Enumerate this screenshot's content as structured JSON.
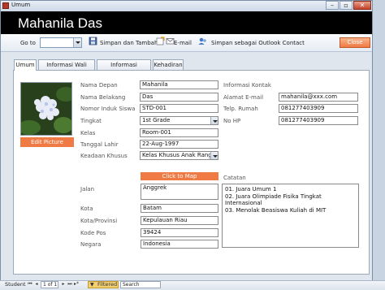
{
  "window": {
    "title": "Umum"
  },
  "header": {
    "title": "Mahanila Das"
  },
  "toolbar": {
    "goto_label": "Go to",
    "goto_value": "",
    "save_new_label": "Simpan dan Tambah",
    "email_label": "E-mail",
    "save_outlook_label": "Simpan sebagai  Outlook Contact",
    "close_label": "Close"
  },
  "tabs": [
    "Umum",
    "Informasi Wali Murid",
    "Informasi Kesehatan",
    "Kehadiran"
  ],
  "photo": {
    "edit_label": "Edit Picture"
  },
  "form": {
    "nama_depan": {
      "label": "Nama Depan",
      "value": "Mahanila"
    },
    "nama_belakang": {
      "label": "Nama Belakang",
      "value": "Das"
    },
    "nomor_induk": {
      "label": "Nomor Induk Siswa",
      "value": "STD-001"
    },
    "tingkat": {
      "label": "Tingkat",
      "value": "1st Grade"
    },
    "kelas": {
      "label": "Kelas",
      "value": "Room-001"
    },
    "tanggal_lahir": {
      "label": "Tanggal Lahir",
      "value": "22-Aug-1997"
    },
    "keadaan_khusus": {
      "label": "Keadaan Khusus",
      "value": "Kelas Khusus Anak Rangkir"
    }
  },
  "contact": {
    "section_title": "Informasi Kontak",
    "email": {
      "label": "Alamat E-mail",
      "value": "mahanila@xxx.com"
    },
    "telp": {
      "label": "Telp. Rumah",
      "value": "081277403909"
    },
    "hp": {
      "label": "No HP",
      "value": "081277403909"
    }
  },
  "address": {
    "map_label": "Click to Map",
    "jalan": {
      "label": "Jalan",
      "value": "Anggrek"
    },
    "kota": {
      "label": "Kota",
      "value": "Batam"
    },
    "provinsi": {
      "label": "Kota/Provinsi",
      "value": "Kepulauan Riau"
    },
    "kode_pos": {
      "label": "Kode Pos",
      "value": "39424"
    },
    "negara": {
      "label": "Negara",
      "value": "Indonesia"
    }
  },
  "notes": {
    "label": "Catatan",
    "lines": [
      "01. Juara Umum 1",
      "02. Juara Olimpiade Fisika Tingkat Internasional",
      "03. Menolak Beasiswa Kuliah di MIT"
    ]
  },
  "statusbar": {
    "record_label": "Student",
    "record_pos": "1 of 1",
    "filter_label": "Filtered",
    "search_label": "Search"
  },
  "colors": {
    "accent": "#EF7A44",
    "header": "#000000"
  }
}
